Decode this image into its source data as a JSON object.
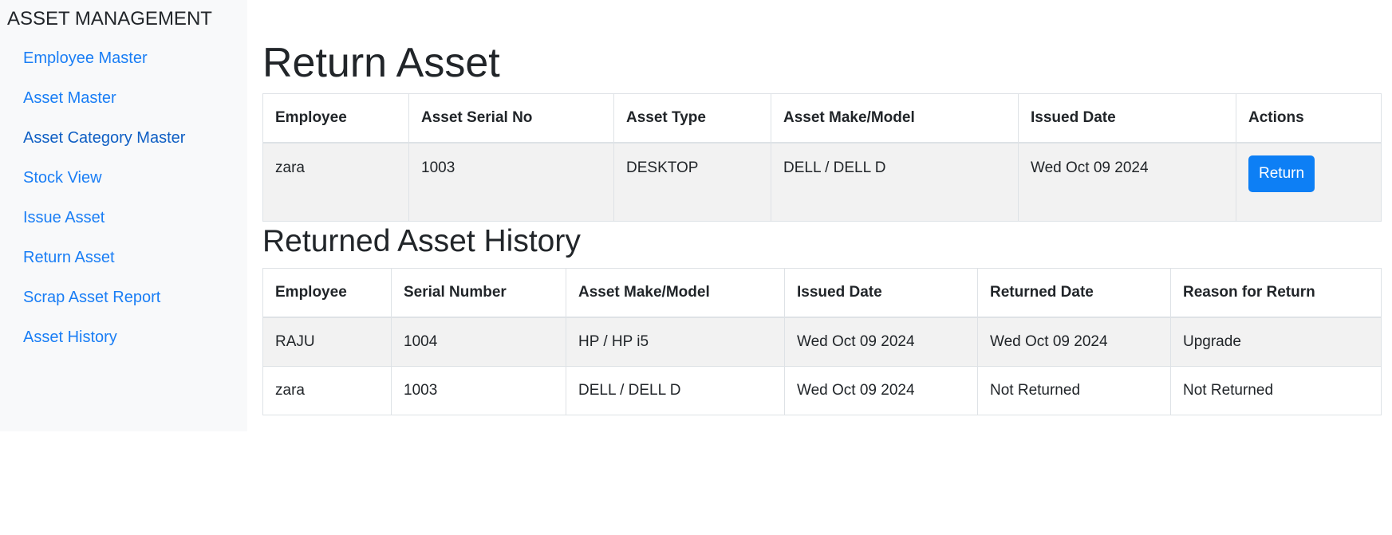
{
  "sidebar": {
    "brand": "ASSET MANAGEMENT",
    "items": [
      {
        "label": "Employee Master"
      },
      {
        "label": "Asset Master"
      },
      {
        "label": "Asset Category Master"
      },
      {
        "label": "Stock View"
      },
      {
        "label": "Issue Asset"
      },
      {
        "label": "Return Asset"
      },
      {
        "label": "Scrap Asset Report"
      },
      {
        "label": "Asset History"
      }
    ]
  },
  "return_section": {
    "title": "Return Asset",
    "columns": [
      "Employee",
      "Asset Serial No",
      "Asset Type",
      "Asset Make/Model",
      "Issued Date",
      "Actions"
    ],
    "rows": [
      {
        "employee": "zara",
        "serial": "1003",
        "type": "DESKTOP",
        "make_model": "DELL / DELL D",
        "issued_date": "Wed Oct 09 2024",
        "action_label": "Return"
      }
    ]
  },
  "history_section": {
    "title": "Returned Asset History",
    "columns": [
      "Employee",
      "Serial Number",
      "Asset Make/Model",
      "Issued Date",
      "Returned Date",
      "Reason for Return"
    ],
    "rows": [
      {
        "employee": "RAJU",
        "serial": "1004",
        "make_model": "HP / HP i5",
        "issued_date": "Wed Oct 09 2024",
        "returned_date": "Wed Oct 09 2024",
        "reason": "Upgrade"
      },
      {
        "employee": "zara",
        "serial": "1003",
        "make_model": "DELL / DELL D",
        "issued_date": "Wed Oct 09 2024",
        "returned_date": "Not Returned",
        "reason": "Not Returned"
      }
    ]
  },
  "colors": {
    "link": "#1a7ef5",
    "primary_button": "#0d7ff5",
    "sidebar_bg": "#f8f9fa",
    "stripe_bg": "#f2f2f2"
  }
}
